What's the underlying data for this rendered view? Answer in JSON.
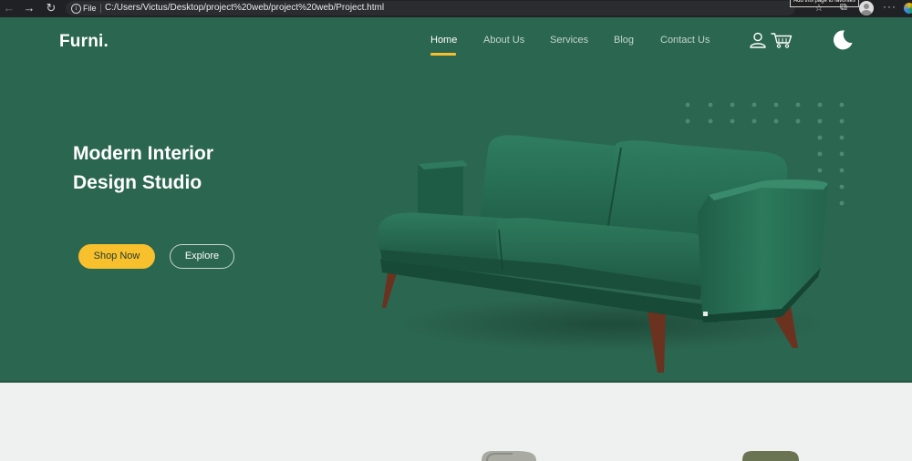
{
  "browser": {
    "scheme_label": "File",
    "url": "C:/Users/Victus/Desktop/project%20web/project%20web/Project.html",
    "tooltip_text": "Add this page to favorites",
    "icons": {
      "back": "arrow-left-icon",
      "forward": "arrow-right-icon",
      "reload": "reload-icon",
      "info": "info-icon",
      "favorites": "star-icon",
      "collections": "collections-icon",
      "profile": "avatar",
      "more": "ellipsis-icon"
    }
  },
  "site": {
    "logo": "Furni.",
    "nav": [
      {
        "label": "Home",
        "active": true
      },
      {
        "label": "About Us",
        "active": false
      },
      {
        "label": "Services",
        "active": false
      },
      {
        "label": "Blog",
        "active": false
      },
      {
        "label": "Contact Us",
        "active": false
      }
    ],
    "icons": {
      "user": "user-icon",
      "cart": "cart-icon",
      "theme": "moon-icon"
    }
  },
  "hero": {
    "title_line1": "Modern Interior",
    "title_line2": "Design Studio",
    "primary_button": "Shop Now",
    "secondary_button": "Explore"
  },
  "colors": {
    "hero_background": "#2b6650",
    "accent": "#f9c02e",
    "section_background": "#eef1ef"
  }
}
